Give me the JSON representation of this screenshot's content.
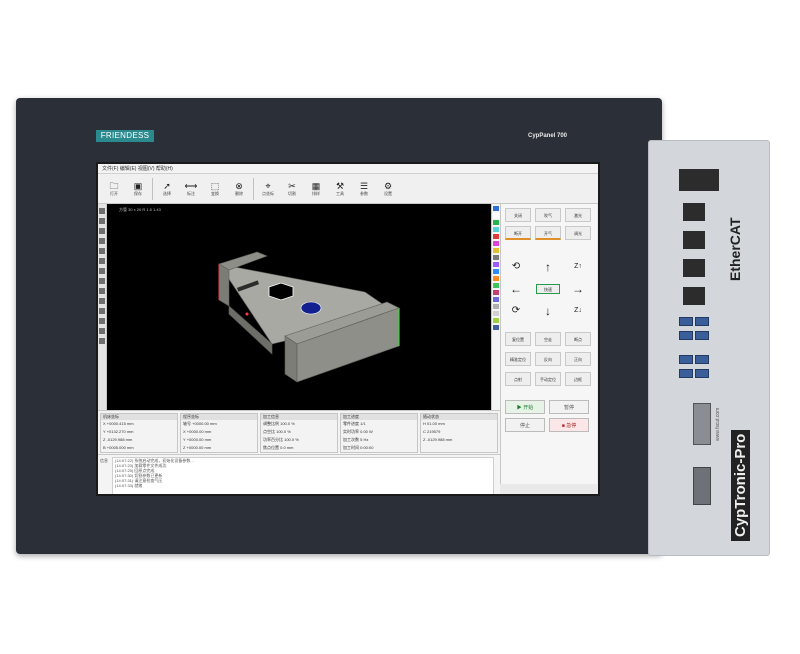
{
  "device": {
    "brand": "FRIENDESS",
    "model": "CypPanel 700",
    "side_label": "CypTronic-Pro",
    "ethercat": "EtherCAT",
    "url": "www.fscut.com"
  },
  "toolbar": {
    "items": [
      {
        "label": "打开",
        "icon": "folder-icon"
      },
      {
        "label": "保存",
        "icon": "save-icon"
      },
      {
        "label": "选择",
        "icon": "cursor-icon"
      },
      {
        "label": "标注",
        "icon": "dim-icon"
      },
      {
        "label": "变换",
        "icon": "transform-icon"
      },
      {
        "label": "删除",
        "icon": "delete-icon"
      },
      {
        "label": "点坐标",
        "icon": "point-icon"
      },
      {
        "label": "切割",
        "icon": "cut-icon"
      },
      {
        "label": "排样",
        "icon": "nest-icon"
      },
      {
        "label": "工具",
        "icon": "tool-icon"
      },
      {
        "label": "参数",
        "icon": "param-icon"
      },
      {
        "label": "设置",
        "icon": "gear-icon"
      }
    ]
  },
  "canvas": {
    "coords": "方管 30 x 20 R 1.5 1.43"
  },
  "colors": [
    "#2f6fd6",
    "#ffffff",
    "#29b34a",
    "#58d2d2",
    "#e03c3c",
    "#d845d8",
    "#e0c030",
    "#7a7a7a",
    "#9b5cff",
    "#2c8cff",
    "#ff8a1f",
    "#40c060",
    "#c04070",
    "#6b6bd6",
    "#b0b0b0",
    "#d0d0d0",
    "#a0d040",
    "#4060a0"
  ],
  "rpanel": {
    "top_buttons": [
      "关闭",
      "吹气",
      "激光",
      "断开",
      "开气",
      "调光"
    ],
    "jog_speed": "快速",
    "mid_buttons": [
      "复位置",
      "空走",
      "断点"
    ],
    "mid2_buttons": [
      "精准定位",
      "反向",
      "正向"
    ],
    "mid3_buttons": [
      "点射",
      "手动定位",
      "边框"
    ],
    "start": "开始",
    "pause": "暂停",
    "stop": "停止",
    "hold": "急停"
  },
  "info": [
    {
      "title": "机床坐标",
      "rows": [
        "X  +0000.415 mm",
        "Y  +0132.270 mm",
        "Z  -0129.988 mm",
        "B  +0005.000 mm"
      ]
    },
    {
      "title": "程序坐标",
      "rows": [
        "轴号  +0000.00 mm",
        "X  +0000.00 mm",
        "Y  +0000.00 mm",
        "Z  +0000.00 mm"
      ]
    },
    {
      "title": "加工信息",
      "rows": [
        "调整比例  100.0 %",
        "点空比  100.0 %",
        "功率百分比  100.0 %",
        "焦点位置  0.0 mm"
      ]
    },
    {
      "title": "加工进度",
      "rows": [
        "零件进度  1/1",
        "实时功率  0.00 W",
        "加工次数  5 Hz",
        "加工时间  0:00:00"
      ]
    },
    {
      "title": "随动状态",
      "rows": [
        "H  01.00 mm",
        "C  219579",
        "Z  -0129.988 mm",
        " "
      ]
    }
  ],
  "log": {
    "label": "信息",
    "lines": [
      "(14:07:22) 系统启动完成，初始化设备参数...",
      "(14:07:23) 加载零件文件成功",
      "(14:07:25) 回原点完成",
      "(14:07:30) 切割参数已更新",
      "(14:07:31) 请注意检查气压",
      "(14:07:33) 就绪"
    ]
  }
}
